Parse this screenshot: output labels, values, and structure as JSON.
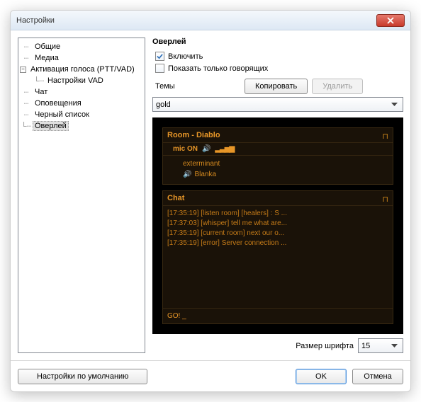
{
  "window": {
    "title": "Настройки"
  },
  "tree": {
    "items": [
      {
        "label": "Общие",
        "depth": 1
      },
      {
        "label": "Медиа",
        "depth": 1
      },
      {
        "label": "Активация голоса (PTT/VAD)",
        "depth": 1,
        "expander": "−"
      },
      {
        "label": "Настройки VAD",
        "depth": 2
      },
      {
        "label": "Чат",
        "depth": 1
      },
      {
        "label": "Оповещения",
        "depth": 1
      },
      {
        "label": "Черный список",
        "depth": 1
      },
      {
        "label": "Оверлей",
        "depth": 1,
        "selected": true
      }
    ]
  },
  "section": {
    "title": "Оверлей",
    "enable_label": "Включить",
    "show_speaking_label": "Показать только говорящих",
    "themes_label": "Темы",
    "copy_btn": "Копировать",
    "delete_btn": "Удалить",
    "theme_value": "gold",
    "fontsize_label": "Размер шрифта",
    "fontsize_value": "15"
  },
  "preview": {
    "room_title": "Room - Diablo",
    "mic_label": "mic ON",
    "users": [
      "exterminant",
      "Blanka"
    ],
    "chat_title": "Chat",
    "messages": [
      "[17:35:19] [listen room] [healers] : S ...",
      "[17:37:03] [whisper] tell me what are...",
      "[17:35:19] [current room] next our o...",
      "[17:35:19] [error] Server connection ..."
    ],
    "input_text": "GO! _"
  },
  "footer": {
    "defaults_btn": "Настройки по умолчанию",
    "ok_btn": "OK",
    "cancel_btn": "Отмена"
  }
}
